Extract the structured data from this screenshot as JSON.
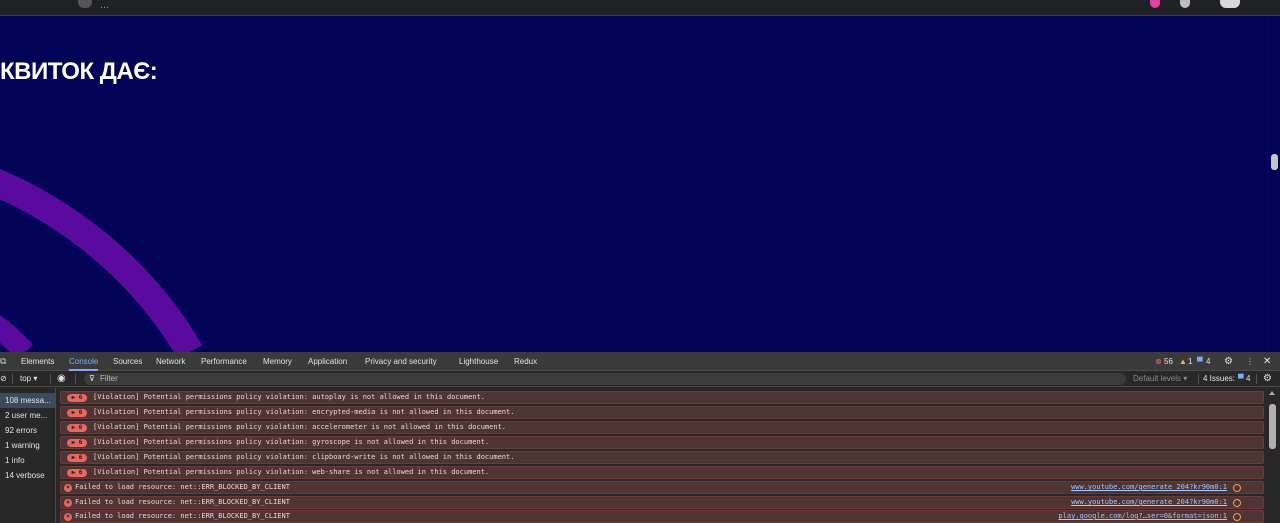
{
  "browser": {
    "url_fragment": "...",
    "colors": {
      "chrome": "#202124"
    }
  },
  "page": {
    "heading": "КВИТОК ДАЄ:",
    "colors": {
      "background": "#020256",
      "arc": "#5a0a9e"
    }
  },
  "devtools": {
    "tabs": [
      "Elements",
      "Console",
      "Sources",
      "Network",
      "Performance",
      "Memory",
      "Application",
      "Privacy and security",
      "Lighthouse",
      "Redux"
    ],
    "active_tab": "Console",
    "counts": {
      "errors": "56",
      "warnings": "1",
      "info": "4"
    },
    "toolbar": {
      "context": "top ▾",
      "filter_placeholder": "Filter",
      "levels": "Default levels ▾",
      "issues_label": "4 Issues:",
      "issues_count": "4"
    },
    "sidebar": [
      "108 messa...",
      "2 user me...",
      "92 errors",
      "1 warning",
      "1 info",
      "14 verbose"
    ],
    "violation_badge": "▶ 6",
    "messages": [
      {
        "text": "[Violation] Potential permissions policy violation: autoplay is not allowed in this document.",
        "link": ""
      },
      {
        "text": "[Violation] Potential permissions policy violation: encrypted-media is not allowed in this document.",
        "link": ""
      },
      {
        "text": "[Violation] Potential permissions policy violation: accelerometer is not allowed in this document.",
        "link": ""
      },
      {
        "text": "[Violation] Potential permissions policy violation: gyroscope is not allowed in this document.",
        "link": ""
      },
      {
        "text": "[Violation] Potential permissions policy violation: clipboard-write is not allowed in this document.",
        "link": ""
      },
      {
        "text": "[Violation] Potential permissions policy violation: web-share is not allowed in this document.",
        "link": ""
      },
      {
        "text": "Failed to load resource: net::ERR_BLOCKED_BY_CLIENT",
        "link": "www.youtube.com/generate_204?kr90m0:1"
      },
      {
        "text": "Failed to load resource: net::ERR_BLOCKED_BY_CLIENT",
        "link": "www.youtube.com/generate_204?kr90m0:1"
      },
      {
        "text": "Failed to load resource: net::ERR_BLOCKED_BY_CLIENT",
        "link": "play.google.com/log?…ser=0&format=json:1"
      }
    ]
  }
}
